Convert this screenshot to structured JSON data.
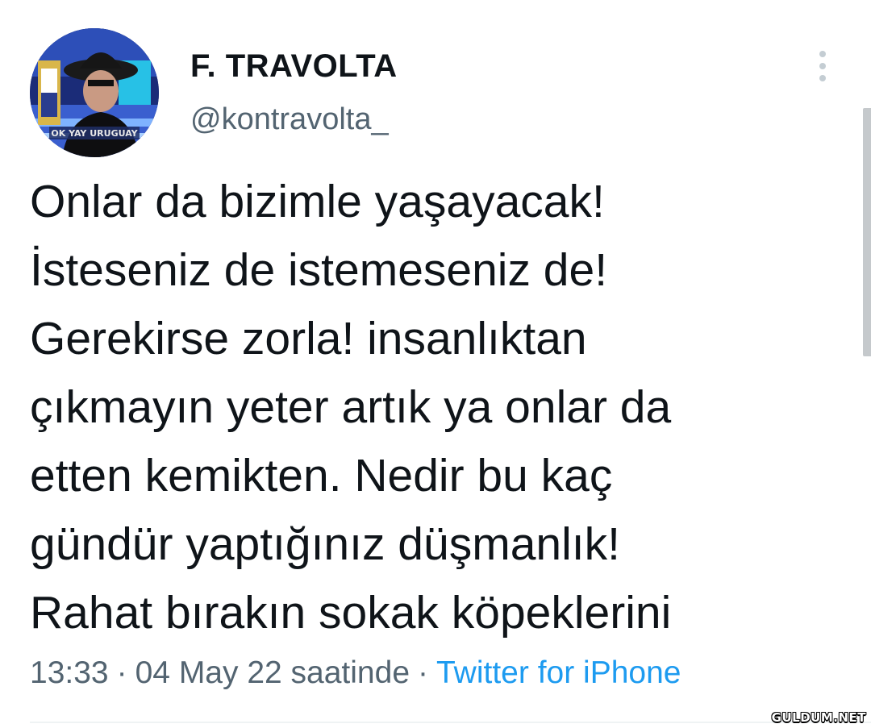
{
  "user": {
    "display_name": "F. TRAVOLTA",
    "handle": "@kontravolta_",
    "avatar_caption": "OK YAY URUGUAY"
  },
  "tweet": {
    "lines": [
      "Onlar da bizimle yaşayacak!",
      "İsteseniz de istemeseniz de!",
      "Gerekirse zorla! insanlıktan",
      "çıkmayın yeter artık ya onlar da",
      "etten kemikten. Nedir bu kaç",
      "gündür yaptığınız düşmanlık!",
      "Rahat bırakın sokak köpeklerini"
    ]
  },
  "meta": {
    "time": "13:33",
    "separator": "·",
    "date_text": "04 May 22 saatinde",
    "source": "Twitter for iPhone"
  },
  "icons": {
    "more": "more-vertical-icon"
  },
  "colors": {
    "text": "#0f1419",
    "secondary": "#536471",
    "link": "#1d9bf0"
  },
  "watermark": "GULDUM.NET"
}
